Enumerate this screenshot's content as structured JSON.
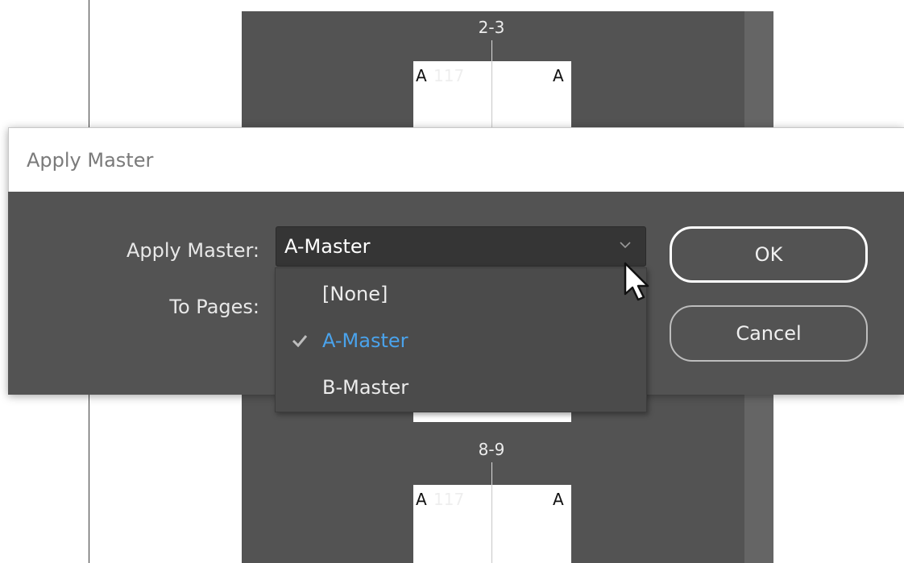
{
  "background": {
    "spreads": [
      {
        "label": "2-3",
        "left_letter": "A",
        "right_letter": "A",
        "faint_number": "117"
      },
      {
        "label": "8-9",
        "left_letter": "A",
        "right_letter": "A",
        "faint_number": "117"
      }
    ]
  },
  "dialog": {
    "title": "Apply Master",
    "apply_master_label": "Apply Master:",
    "to_pages_label": "To Pages:",
    "dropdown_value": "A-Master",
    "dropdown_icon": "chevron-down-icon",
    "menu_items": [
      {
        "label": "[None]",
        "checked": false
      },
      {
        "label": "A-Master",
        "checked": true
      },
      {
        "label": "B-Master",
        "checked": false
      }
    ],
    "ok_label": "OK",
    "cancel_label": "Cancel"
  },
  "colors": {
    "panel": "#535353",
    "dropdown_bg": "#353535",
    "selected_item": "#4aa3ec"
  }
}
